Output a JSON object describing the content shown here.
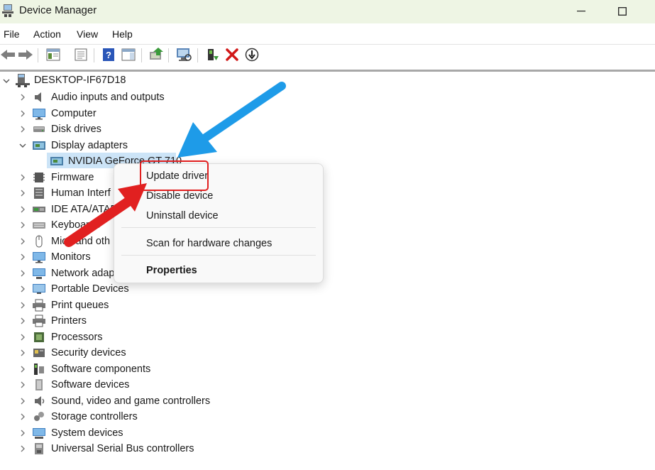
{
  "window": {
    "title": "Device Manager"
  },
  "menu": [
    "File",
    "Action",
    "View",
    "Help"
  ],
  "tree": {
    "root": "DESKTOP-IF67D18",
    "categories": [
      {
        "label": "Audio inputs and outputs",
        "icon": "speaker-icon"
      },
      {
        "label": "Computer",
        "icon": "monitor-icon"
      },
      {
        "label": "Disk drives",
        "icon": "disk-drive-icon"
      },
      {
        "label": "Display adapters",
        "icon": "display-adapter-icon"
      },
      {
        "label": "NVIDIA GeForce GT 710",
        "icon": "display-adapter-icon"
      },
      {
        "label": "Firmware",
        "icon": "chip-icon"
      },
      {
        "label": "Human Interf",
        "icon": "hid-icon"
      },
      {
        "label": "IDE ATA/ATAPI",
        "icon": "ide-controller-icon"
      },
      {
        "label": "Keyboards",
        "icon": "keyboard-icon"
      },
      {
        "label": "Mice and oth",
        "icon": "mouse-icon"
      },
      {
        "label": "Monitors",
        "icon": "monitor-icon"
      },
      {
        "label": "Network adap",
        "icon": "network-icon"
      },
      {
        "label": "Portable Devices",
        "icon": "portable-device-icon"
      },
      {
        "label": "Print queues",
        "icon": "printer-icon"
      },
      {
        "label": "Printers",
        "icon": "printer-icon"
      },
      {
        "label": "Processors",
        "icon": "processor-icon"
      },
      {
        "label": "Security devices",
        "icon": "security-icon"
      },
      {
        "label": "Software components",
        "icon": "software-icon"
      },
      {
        "label": "Software devices",
        "icon": "software-device-icon"
      },
      {
        "label": "Sound, video and game controllers",
        "icon": "sound-icon"
      },
      {
        "label": "Storage controllers",
        "icon": "storage-icon"
      },
      {
        "label": "System devices",
        "icon": "system-icon"
      },
      {
        "label": "Universal Serial Bus controllers",
        "icon": "usb-icon"
      }
    ]
  },
  "context_menu": {
    "update": "Update driver",
    "disable": "Disable device",
    "uninstall": "Uninstall device",
    "scan": "Scan for hardware changes",
    "properties": "Properties"
  },
  "colors": {
    "accent_blue": "#1e9be8",
    "accent_red": "#e12020"
  }
}
